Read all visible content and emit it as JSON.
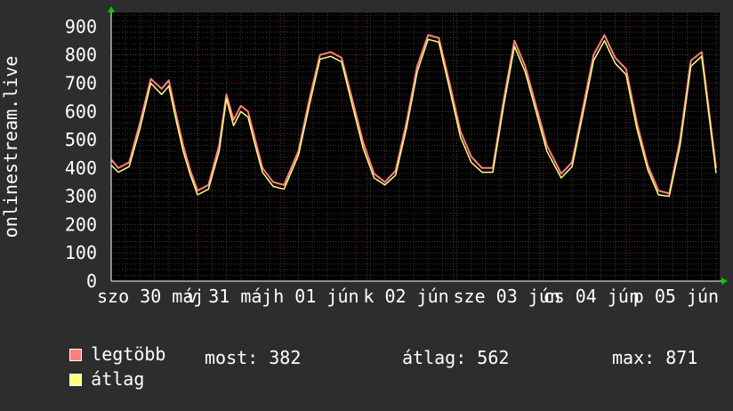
{
  "chart_data": {
    "type": "line",
    "ylabel": "onlinestream.live",
    "ylim": [
      0,
      950
    ],
    "yticks": [
      0,
      100,
      200,
      300,
      400,
      500,
      600,
      700,
      800,
      900
    ],
    "xlim": [
      0,
      8.45
    ],
    "xticks": [
      {
        "x": 0,
        "label": "szo 30 máj"
      },
      {
        "x": 1.2,
        "label": "v 31 máj"
      },
      {
        "x": 2.35,
        "label": "h 01 jún"
      },
      {
        "x": 3.55,
        "label": "k 02 jún"
      },
      {
        "x": 4.75,
        "label": "sze 03 jún"
      },
      {
        "x": 5.95,
        "label": "cs 04 jún"
      },
      {
        "x": 7.15,
        "label": "p 05 jún"
      }
    ],
    "grid": true,
    "series": [
      {
        "name": "legtöbb",
        "color": "#ff7f7f",
        "x": [
          0,
          0.1,
          0.25,
          0.4,
          0.55,
          0.7,
          0.8,
          0.9,
          1.0,
          1.1,
          1.2,
          1.35,
          1.5,
          1.6,
          1.7,
          1.8,
          1.9,
          2.0,
          2.1,
          2.25,
          2.4,
          2.6,
          2.75,
          2.9,
          3.05,
          3.2,
          3.35,
          3.5,
          3.65,
          3.8,
          3.95,
          4.1,
          4.25,
          4.4,
          4.55,
          4.7,
          4.85,
          5.0,
          5.15,
          5.3,
          5.45,
          5.6,
          5.75,
          5.9,
          6.05,
          6.25,
          6.4,
          6.55,
          6.7,
          6.85,
          7.0,
          7.15,
          7.3,
          7.45,
          7.6,
          7.75,
          7.9,
          8.05,
          8.2,
          8.4
        ],
        "values": [
          430,
          400,
          420,
          560,
          715,
          680,
          710,
          590,
          480,
          390,
          320,
          340,
          480,
          660,
          570,
          620,
          600,
          500,
          400,
          350,
          340,
          460,
          640,
          800,
          810,
          790,
          640,
          490,
          380,
          350,
          390,
          560,
          760,
          870,
          860,
          700,
          530,
          440,
          400,
          400,
          640,
          850,
          760,
          620,
          480,
          380,
          420,
          610,
          800,
          870,
          790,
          750,
          560,
          410,
          320,
          310,
          500,
          780,
          810,
          400
        ]
      },
      {
        "name": "átlag",
        "color": "#ffff7f",
        "x": [
          0,
          0.1,
          0.25,
          0.4,
          0.55,
          0.7,
          0.8,
          0.9,
          1.0,
          1.1,
          1.2,
          1.35,
          1.5,
          1.6,
          1.7,
          1.8,
          1.9,
          2.0,
          2.1,
          2.25,
          2.4,
          2.6,
          2.75,
          2.9,
          3.05,
          3.2,
          3.35,
          3.5,
          3.65,
          3.8,
          3.95,
          4.1,
          4.25,
          4.4,
          4.55,
          4.7,
          4.85,
          5.0,
          5.15,
          5.3,
          5.45,
          5.6,
          5.75,
          5.9,
          6.05,
          6.25,
          6.4,
          6.55,
          6.7,
          6.85,
          7.0,
          7.15,
          7.3,
          7.45,
          7.6,
          7.75,
          7.9,
          8.05,
          8.2,
          8.4
        ],
        "values": [
          410,
          385,
          405,
          540,
          700,
          660,
          690,
          570,
          460,
          375,
          305,
          325,
          460,
          645,
          550,
          600,
          580,
          480,
          385,
          335,
          325,
          445,
          620,
          785,
          795,
          775,
          620,
          470,
          365,
          340,
          375,
          540,
          740,
          855,
          845,
          680,
          510,
          420,
          385,
          385,
          620,
          830,
          740,
          600,
          460,
          365,
          405,
          590,
          780,
          850,
          770,
          730,
          540,
          395,
          305,
          300,
          480,
          760,
          795,
          382
        ]
      }
    ]
  },
  "legend": [
    {
      "label": "legtöbb",
      "color": "#ff7f7f"
    },
    {
      "label": "átlag",
      "color": "#ffff7f"
    }
  ],
  "stats": {
    "now": "most: 382",
    "avg": "átlag: 562",
    "max": "max: 871"
  }
}
